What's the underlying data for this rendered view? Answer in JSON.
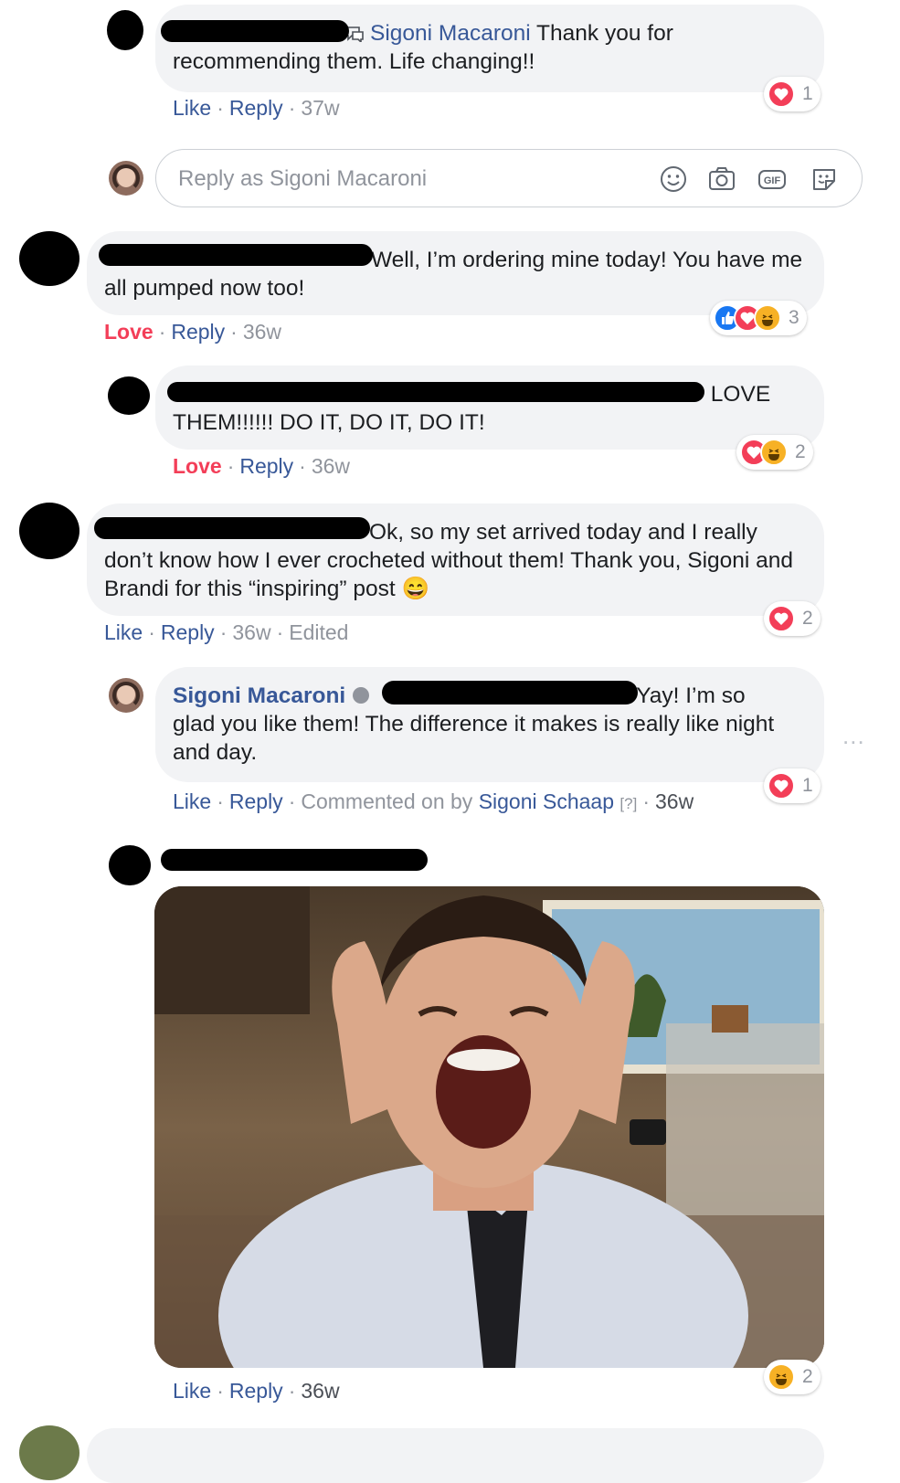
{
  "colors": {
    "link": "#385898",
    "love": "#f33e58",
    "like": "#1877f2",
    "haha": "#f7b125",
    "muted": "#90949c",
    "bubble": "#f2f3f5"
  },
  "comments": [
    {
      "mention": "Sigoni Macaroni",
      "text": " Thank you for recommending them. Life changing!!",
      "actions": {
        "like": "Like",
        "reply": "Reply",
        "time": "37w"
      },
      "reactions": {
        "types": [
          "love"
        ],
        "count": "1"
      }
    },
    {
      "text": "Well, I’m ordering mine today! You have me all pumped now too!",
      "actions": {
        "like": "Love",
        "reply": "Reply",
        "time": "36w"
      },
      "reactions": {
        "types": [
          "like",
          "love",
          "haha"
        ],
        "count": "3"
      }
    },
    {
      "text": " LOVE THEM!!!!!! DO IT, DO IT, DO IT!",
      "actions": {
        "like": "Love",
        "reply": "Reply",
        "time": "36w"
      },
      "reactions": {
        "types": [
          "love",
          "haha"
        ],
        "count": "2"
      }
    },
    {
      "text": "Ok, so my set arrived today and I really don’t know how I ever crocheted without them! Thank you, Sigoni and Brandi for this “inspiring” post",
      "emoji": "😄",
      "actions": {
        "like": "Like",
        "reply": "Reply",
        "time": "36w",
        "edited": "Edited"
      },
      "reactions": {
        "types": [
          "love"
        ],
        "count": "2"
      }
    },
    {
      "author": "Sigoni Macaroni",
      "text": "Yay! I’m so glad you like them! The difference it makes is really like night and day.",
      "actions": {
        "like": "Like",
        "reply": "Reply",
        "commented_on": "Commented on by",
        "commenter": "Sigoni Schaap",
        "help": "[?]",
        "time": "36w"
      },
      "reactions": {
        "types": [
          "love"
        ],
        "count": "1"
      }
    },
    {
      "actions": {
        "like": "Like",
        "reply": "Reply",
        "time": "36w"
      },
      "reactions": {
        "types": [
          "haha"
        ],
        "count": "2"
      }
    }
  ],
  "reply_box": {
    "placeholder": "Reply as Sigoni Macaroni",
    "icons": [
      "emoji-icon",
      "camera-icon",
      "gif-icon",
      "sticker-icon"
    ]
  },
  "more": "..."
}
